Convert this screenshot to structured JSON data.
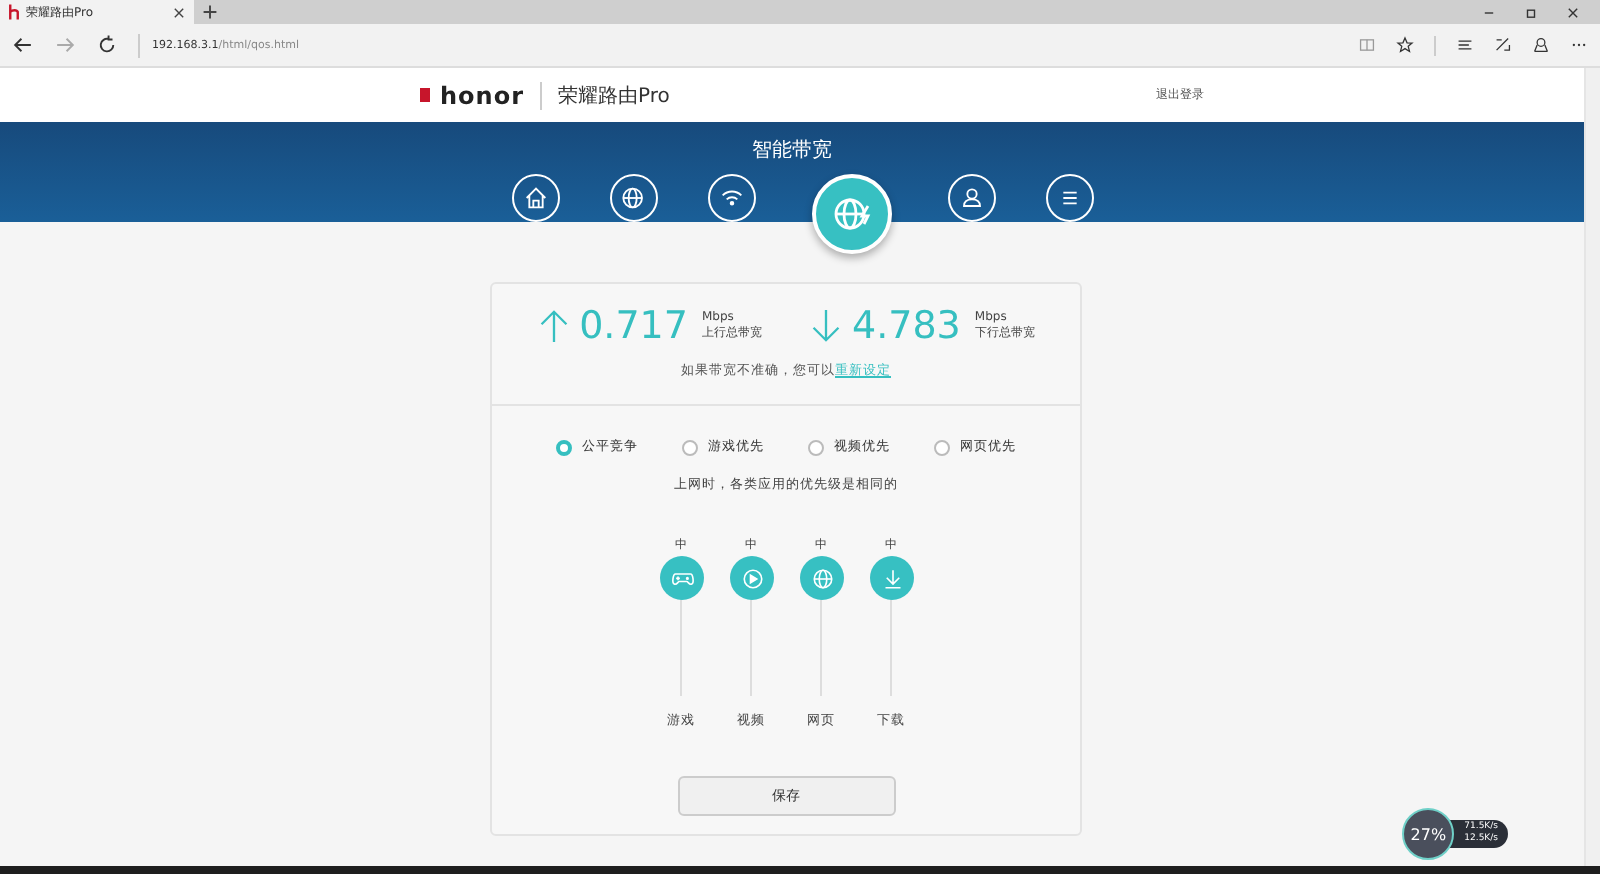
{
  "browser": {
    "tab_title": "荣耀路由Pro",
    "url_host": "192.168.3.1",
    "url_path": "/html/qos.html"
  },
  "header": {
    "brand": "honor",
    "product": "荣耀路由Pro",
    "logout": "退出登录"
  },
  "nav": {
    "title": "智能带宽",
    "items": [
      {
        "kind": "home",
        "selected": false
      },
      {
        "kind": "globe",
        "selected": false
      },
      {
        "kind": "wifi",
        "selected": false
      },
      {
        "kind": "bandwidth",
        "selected": true
      },
      {
        "kind": "user",
        "selected": false
      },
      {
        "kind": "menu",
        "selected": false
      }
    ]
  },
  "bandwidth": {
    "items": [
      {
        "kind": "up",
        "value": "0.717",
        "unit": "Mbps",
        "label": "上行总带宽"
      },
      {
        "kind": "down",
        "value": "4.783",
        "unit": "Mbps",
        "label": "下行总带宽"
      }
    ],
    "hint": "如果带宽不准确，您可以",
    "link": "重新设定"
  },
  "modes": [
    {
      "label": "公平竞争",
      "selected": true
    },
    {
      "label": "游戏优先",
      "selected": false
    },
    {
      "label": "视频优先",
      "selected": false
    },
    {
      "label": "网页优先",
      "selected": false
    }
  ],
  "mode_note": "上网时，各类应用的优先级是相同的",
  "sliders": [
    {
      "kind": "game",
      "value": "中",
      "label": "游戏",
      "level": 1
    },
    {
      "kind": "video",
      "value": "中",
      "label": "视频",
      "level": 1
    },
    {
      "kind": "web",
      "value": "中",
      "label": "网页",
      "level": 1
    },
    {
      "kind": "download",
      "value": "中",
      "label": "下载",
      "level": 1
    }
  ],
  "save": "保存",
  "widget": {
    "percent": "27%",
    "up": "71.5K/s",
    "down": "12.5K/s"
  }
}
